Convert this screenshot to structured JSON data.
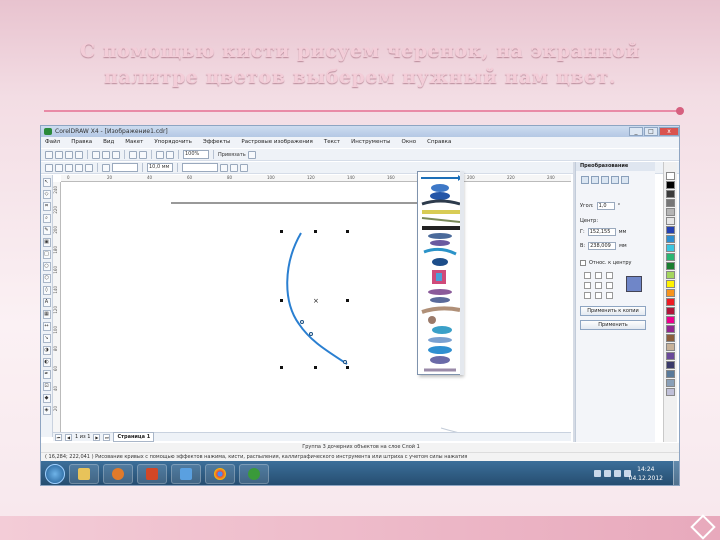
{
  "slide": {
    "title_line1": "С помощью кисти рисуем черенок, на экранной",
    "title_line2": "палитре цветов выберем нужный нам цвет."
  },
  "window": {
    "title": "CorelDRAW X4 - [Изображение1.cdr]",
    "min": "_",
    "max": "□",
    "close": "x"
  },
  "menu": [
    "Файл",
    "Правка",
    "Вид",
    "Макет",
    "Упорядочить",
    "Эффекты",
    "Растровые изображения",
    "Текст",
    "Инструменты",
    "Окно",
    "Справка"
  ],
  "toolbar": {
    "zoom": "100%",
    "stroke_width": "10,0 мм",
    "snap": "Привязать"
  },
  "rulers": {
    "top": [
      "0",
      "20",
      "40",
      "60",
      "80",
      "100",
      "120",
      "140",
      "160",
      "180",
      "200",
      "220",
      "240"
    ],
    "left": [
      "240",
      "220",
      "200",
      "180",
      "160",
      "140",
      "120",
      "100",
      "80",
      "60",
      "40",
      "20"
    ]
  },
  "canvas": {
    "page_nav": {
      "first": "⏮",
      "prev": "◀",
      "counter": "1 из 1",
      "next": "▶",
      "last": "⏭",
      "page_tab": "Страница 1"
    }
  },
  "status": {
    "line1": "Группа 3 дочерних объектов на слое Слой 1",
    "line2": "( 16,284; 222,041 )   Рисование кривых с помощью эффектов нажима, кисти, распыления, каллиграфического инструмента или штриха с учетом силы нажатия"
  },
  "docker": {
    "title": "Преобразование",
    "width_label": "Угол:",
    "width_value": "1,0",
    "unit": "°",
    "center_label": "Центр:",
    "x_label": "Г:",
    "x_value": "152,155",
    "y_label": "В:",
    "y_value": "238,009",
    "mm": "мм",
    "relative": "Относ. к центру",
    "apply_dup": "Применить к копии",
    "apply": "Применить"
  },
  "taskbar": {
    "time": "14:24",
    "date": "04.12.2012"
  },
  "colors": {
    "title_pink": "#f3cdd8",
    "accent_line": "#e98aa6",
    "stroke_blue": "#2a7fd1"
  },
  "icons": {
    "start": "windows-start-icon",
    "taskbar_apps": [
      "explorer-icon",
      "media-player-icon",
      "powerpoint-icon",
      "paint-icon",
      "chrome-icon",
      "coreldraw-icon"
    ]
  }
}
